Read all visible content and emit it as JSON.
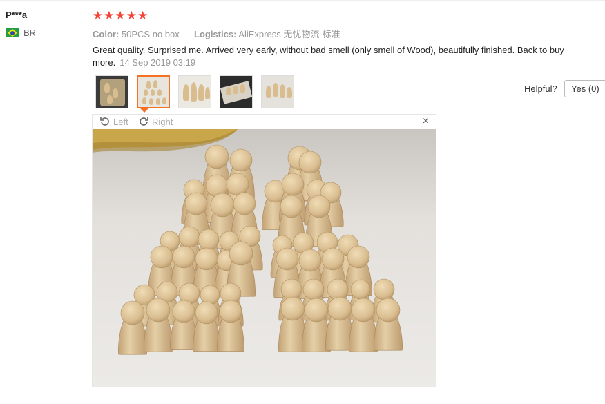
{
  "user": {
    "name": "P***a",
    "country_code": "BR"
  },
  "rating": {
    "stars": 5
  },
  "sku": {
    "color_label": "Color:",
    "color_value": "50PCS no box",
    "logistics_label": "Logistics:",
    "logistics_value": "AliExpress 无忧物流-标准"
  },
  "review": {
    "text": "Great quality. Surprised me. Arrived very early, without bad smell (only smell of Wood), beautifully finished. Back to buy more.",
    "date": "14 Sep 2019 03:19"
  },
  "thumbnails": {
    "count": 5,
    "active_index": 1
  },
  "helpful": {
    "label": "Helpful?",
    "yes_label": "Yes (0)"
  },
  "viewer": {
    "rotate_left_label": "Left",
    "rotate_right_label": "Right",
    "close_label": "×"
  },
  "colors": {
    "star": "#f44336",
    "active_thumb_border": "#f57224",
    "muted_text": "#999999"
  }
}
